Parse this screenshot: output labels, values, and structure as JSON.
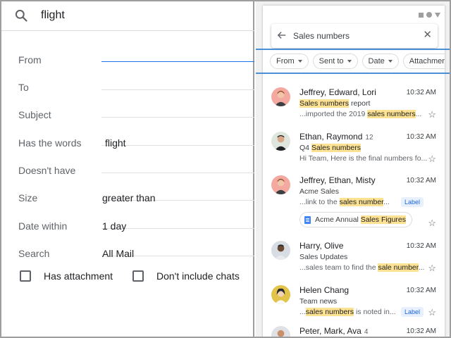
{
  "left": {
    "search_query": "flight",
    "fields": [
      {
        "label": "From",
        "value": ""
      },
      {
        "label": "To",
        "value": ""
      },
      {
        "label": "Subject",
        "value": ""
      },
      {
        "label": "Has the words",
        "value": "flight"
      },
      {
        "label": "Doesn't have",
        "value": ""
      },
      {
        "label": "Size",
        "value": "greater than"
      },
      {
        "label": "Date within",
        "value": "1 day"
      },
      {
        "label": "Search",
        "value": "All Mail"
      }
    ],
    "checkboxes": [
      {
        "label": "Has attachment"
      },
      {
        "label": "Don't include chats"
      }
    ]
  },
  "right": {
    "search_text": "Sales numbers",
    "chips": [
      {
        "label": "From"
      },
      {
        "label": "Sent to"
      },
      {
        "label": "Date"
      },
      {
        "label": "Attachment"
      }
    ],
    "messages": [
      {
        "sender": "Jeffrey, Edward, Lori",
        "count": "",
        "time": "10:32 AM",
        "subject_pre": "",
        "subject_hl": "Sales numbers",
        "subject_post": " report",
        "snip_pre": "...imported the 2019 ",
        "snip_hl": "sales numbers",
        "snip_post": "...",
        "label": ""
      },
      {
        "sender": "Ethan, Raymond",
        "count": "12",
        "time": "10:32 AM",
        "subject_pre": "Q4 ",
        "subject_hl": "Sales numbers",
        "subject_post": "",
        "snip_pre": "Hi Team, Here is the final numbers fo...",
        "snip_hl": "",
        "snip_post": "",
        "label": ""
      },
      {
        "sender": "Jeffrey, Ethan, Misty",
        "count": "",
        "time": "10:32 AM",
        "subject_pre": "Acme Sales",
        "subject_hl": "",
        "subject_post": "",
        "snip_pre": "...link to the ",
        "snip_hl": "sales number",
        "snip_post": "...",
        "label": "Label",
        "attachment_pre": "Acme Annual ",
        "attachment_hl": "Sales Figures"
      },
      {
        "sender": "Harry, Olive",
        "count": "",
        "time": "10:32 AM",
        "subject_pre": "Sales Updates",
        "subject_hl": "",
        "subject_post": "",
        "snip_pre": "...sales team to find the ",
        "snip_hl": "sale number",
        "snip_post": "...",
        "label": ""
      },
      {
        "sender": "Helen Chang",
        "count": "",
        "time": "10:32 AM",
        "subject_pre": "Team news",
        "subject_hl": "",
        "subject_post": "",
        "snip_pre": "...",
        "snip_hl": "sales numbers",
        "snip_post": " is noted in...",
        "label": "Label"
      },
      {
        "sender": "Peter, Mark, Ava",
        "count": "4",
        "time": "10:32 AM",
        "subject_pre": "",
        "subject_hl": "",
        "subject_post": "",
        "snip_pre": "",
        "snip_hl": "",
        "snip_post": "",
        "label": ""
      }
    ]
  }
}
